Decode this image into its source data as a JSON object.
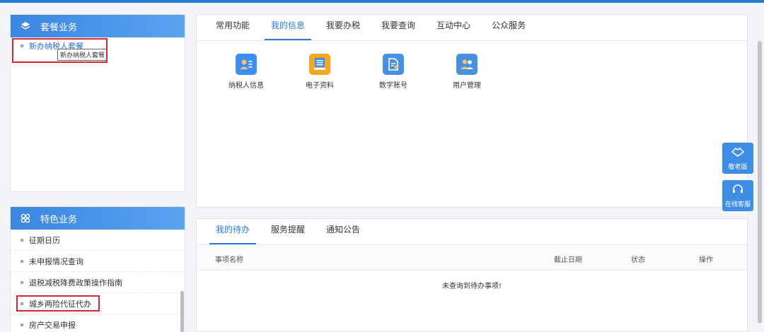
{
  "package_panel": {
    "title": "套餐业务",
    "item": "新办纳税人套餐",
    "tooltip": "新办纳税人套餐"
  },
  "special_panel": {
    "title": "特色业务",
    "items": [
      "征期日历",
      "未申报情况查询",
      "退税减税降费政策操作指南",
      "城乡两险代征代办",
      "房产交易申报"
    ]
  },
  "func_tabs": [
    "常用功能",
    "我的信息",
    "我要办税",
    "我要查询",
    "互动中心",
    "公众服务"
  ],
  "func_active_tab": "我的信息",
  "functions": [
    {
      "label": "纳税人信息",
      "icon": "taxpayer-info-icon",
      "color": "#3d8ef0"
    },
    {
      "label": "电子资料",
      "icon": "electronic-data-icon",
      "color": "#f5a623"
    },
    {
      "label": "数字账号",
      "icon": "digital-account-icon",
      "color": "#4a90e2"
    },
    {
      "label": "用户管理",
      "icon": "user-management-icon",
      "color": "#4a90e2"
    }
  ],
  "todo_tabs": [
    "我的待办",
    "服务提醒",
    "通知公告"
  ],
  "todo_active_tab": "我的待办",
  "todo_columns": [
    "事项名称",
    "截止日期",
    "状态",
    "操作"
  ],
  "todo_empty": "未查询到待办事项!",
  "float_buttons": {
    "elder": "敬老版",
    "service": "在线客服"
  },
  "colors": {
    "primary": "#2b7bd6",
    "highlight_box": "#d9262c"
  }
}
